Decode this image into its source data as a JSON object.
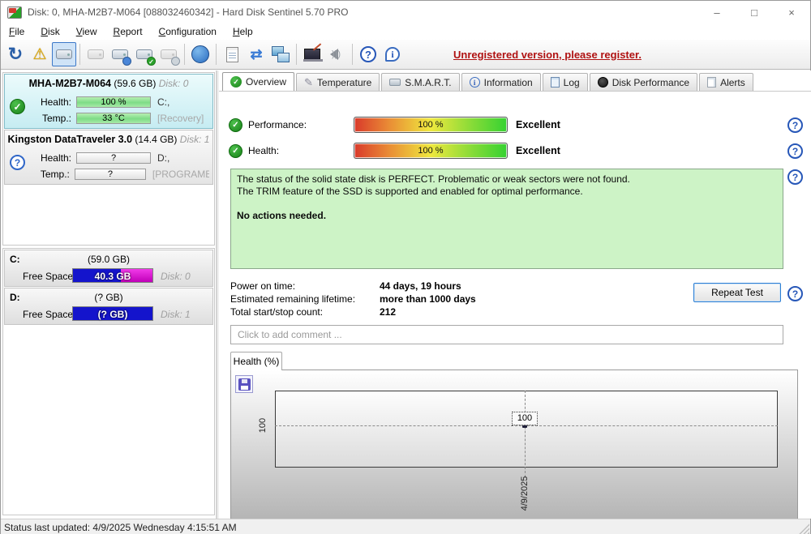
{
  "window": {
    "title": "Disk: 0, MHA-M2B7-M064 [088032460342]  -  Hard Disk Sentinel 5.70 PRO",
    "minimize": "–",
    "maximize": "□",
    "close": "×"
  },
  "menu": {
    "items": [
      {
        "label": "File"
      },
      {
        "label": "Disk"
      },
      {
        "label": "View"
      },
      {
        "label": "Report"
      },
      {
        "label": "Configuration"
      },
      {
        "label": "Help"
      }
    ]
  },
  "toolbar": {
    "register_link": "Unregistered version, please register.",
    "icons": [
      "refresh",
      "disk-warning",
      "disk-detect",
      "disk-disabled",
      "disk-clock",
      "disk-check",
      "disk-search",
      "globe",
      "report",
      "sync",
      "network",
      "remote-config",
      "sound",
      "help",
      "info"
    ]
  },
  "sidebar": {
    "disks": [
      {
        "name": "MHA-M2B7-M064",
        "size": "(59.6 GB)",
        "disk_label": "Disk: 0",
        "health_label": "Health:",
        "health_value": "100 %",
        "temp_label": "Temp.:",
        "temp_value": "33 °C",
        "drive_letters": "C:,",
        "volume_label": "[Recovery]",
        "status": "ok"
      },
      {
        "name": "Kingston DataTraveler 3.0",
        "size": "(14.4 GB)",
        "disk_label": "Disk: 1",
        "health_label": "Health:",
        "health_value": "?",
        "temp_label": "Temp.:",
        "temp_value": "?",
        "drive_letters": "D:,",
        "volume_label": "[PROGRAME",
        "status": "unknown"
      }
    ],
    "partitions": [
      {
        "letter": "C:",
        "size": "(59.0 GB)",
        "free_label": "Free Space",
        "free_value": "40.3 GB",
        "disk_label": "Disk: 0"
      },
      {
        "letter": "D:",
        "size": "(? GB)",
        "free_label": "Free Space",
        "free_value": "(? GB)",
        "disk_label": "Disk: 1"
      }
    ]
  },
  "tabs": [
    {
      "label": "Overview",
      "active": true
    },
    {
      "label": "Temperature",
      "active": false
    },
    {
      "label": "S.M.A.R.T.",
      "active": false
    },
    {
      "label": "Information",
      "active": false
    },
    {
      "label": "Log",
      "active": false
    },
    {
      "label": "Disk Performance",
      "active": false
    },
    {
      "label": "Alerts",
      "active": false
    }
  ],
  "overview": {
    "performance_label": "Performance:",
    "performance_value": "100 %",
    "performance_rating": "Excellent",
    "health_label": "Health:",
    "health_value": "100 %",
    "health_rating": "Excellent",
    "status_lines": [
      "The status of the solid state disk is PERFECT. Problematic or weak sectors were not found.",
      "The TRIM feature of the SSD is supported and enabled for optimal performance."
    ],
    "status_action": "No actions needed.",
    "stats": [
      {
        "label": "Power on time:",
        "value": "44 days, 19 hours"
      },
      {
        "label": "Estimated remaining lifetime:",
        "value": "more than 1000 days"
      },
      {
        "label": "Total start/stop count:",
        "value": "212"
      }
    ],
    "repeat_test": "Repeat Test",
    "comment_placeholder": "Click to add comment ...",
    "chart_tab": "Health (%)"
  },
  "chart_data": {
    "type": "line",
    "title": "Health (%)",
    "x": [
      "4/9/2025"
    ],
    "series": [
      {
        "name": "Health (%)",
        "values": [
          100
        ]
      }
    ],
    "yticks": [
      "100"
    ],
    "grid": "dashed",
    "legend": "none",
    "point_label": "100"
  },
  "status_bar": {
    "text": "Status last updated: 4/9/2025 Wednesday 4:15:51 AM"
  },
  "colors": {
    "register_link": "#b01212",
    "status_box_green": "#cdf3c6",
    "meter_gradient": [
      "#d93a2b",
      "#efe83e",
      "#35d232"
    ],
    "sidebar_selected": "#c6ecf2",
    "health_bar_green": "#7edc86",
    "free_space_blue": "#1414cc",
    "free_space_magenta": "#dd12d4"
  }
}
